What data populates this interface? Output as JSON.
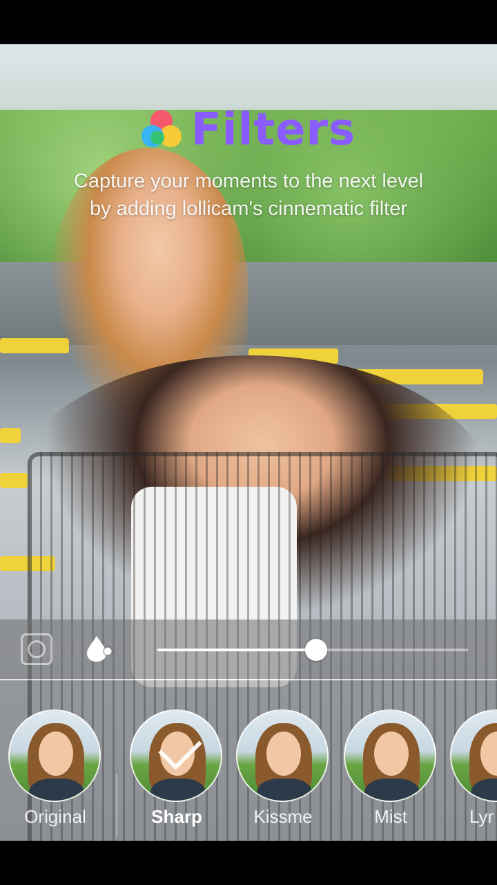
{
  "header": {
    "title": "Filters",
    "subtitle_line1": "Capture your moments to the next level",
    "subtitle_line2": "by adding lollicam's cinnematic filter",
    "title_color": "#8a5cff",
    "logo_colors": [
      "#ff4f6d",
      "#ffcc33",
      "#2fb3ff",
      "#35c46a"
    ]
  },
  "controls": {
    "square_icon": "square-circle-icon",
    "drop_icon": "drop-icon",
    "intensity_percent": 51
  },
  "filters": [
    {
      "label": "Original",
      "selected": false
    },
    {
      "label": "Sharp",
      "selected": true
    },
    {
      "label": "Kissme",
      "selected": false
    },
    {
      "label": "Mist",
      "selected": false
    },
    {
      "label": "Lyr",
      "selected": false
    }
  ]
}
